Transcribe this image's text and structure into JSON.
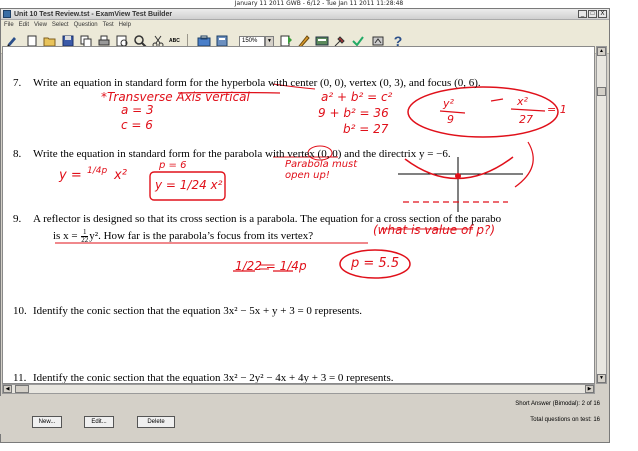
{
  "stamp": "January 11 2011 GWB - 6/12 - Tue Jan 11 2011 11:28:48",
  "window": {
    "title": "Unit 10 Test Review.tst - ExamView Test Builder",
    "min": "_",
    "max": "□",
    "close": "X"
  },
  "menu": [
    "File",
    "Edit",
    "View",
    "Select",
    "Question",
    "Test",
    "Help"
  ],
  "toolbar": {
    "zoom": "150%",
    "icons": [
      "new-test-icon",
      "open-icon",
      "save-icon",
      "print-icon",
      "preview-icon",
      "find-icon",
      "cut-icon",
      "spell-check-icon",
      "toolbox-icon",
      "zoom-icon",
      "question-new-icon",
      "question-edit-icon",
      "question-bank-icon",
      "tools-icon",
      "help-icon"
    ],
    "spell_label": "ABC"
  },
  "questions": [
    {
      "num": "7.",
      "text": "Write an equation in standard form for the hyperbola with center (0, 0), vertex (0, 3), and focus (0, 6)."
    },
    {
      "num": "8.",
      "text": "Write the equation in standard form for the parabola with vertex (0, 0) and the directrix y = −6."
    },
    {
      "num": "9.",
      "text": "A reflector is designed so that its cross section is a parabola. The equation for a cross section of the parabo",
      "text2a": "is x = ",
      "frac_num": "1",
      "frac_den": "22",
      "text2b": "y². How far is the parabola’s focus from its vertex?"
    },
    {
      "num": "10.",
      "text": "Identify the conic section that the equation 3x² − 5x + y + 3 = 0 represents."
    },
    {
      "num": "11.",
      "text": "Identify the conic section that the equation 3x² − 2y² − 4x + 4y + 3 = 0 represents."
    }
  ],
  "handwriting": {
    "q7": {
      "t1": "*Transverse Axis vertical",
      "t2": "a = 3",
      "t3": "c = 6",
      "t4": "a² + b² = c²",
      "t5": "9 + b² = 36",
      "t6": "b² = 27",
      "t7_num": "y²",
      "t7_den": "9",
      "t8_num": "x²",
      "t8_den": "27",
      "t9": "= 1"
    },
    "q8": {
      "t1": "y = ",
      "t2": "1/4p",
      "t3": "x²",
      "t4": "p = 6",
      "t5": "y = 1/24 x²",
      "t6": "Parabola must open up!"
    },
    "q9": {
      "t1": "(what is value of p?)",
      "t2": "1/22 = 1/4p",
      "t3": "p = 5.5"
    }
  },
  "buttons": {
    "new": "New...",
    "edit": "Edit...",
    "delete": "Delete"
  },
  "status": {
    "line1": "Short Answer (Bimodal): 2 of 16",
    "line2": "Total questions on test: 16"
  }
}
